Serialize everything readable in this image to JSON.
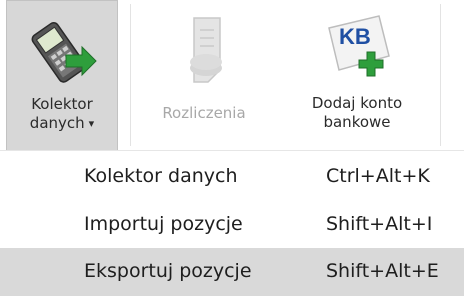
{
  "ribbon": {
    "kolektor": {
      "label_line1": "Kolektor",
      "label_line2": "danych",
      "caret": "▾",
      "icon": "data-collector-icon"
    },
    "rozliczenia": {
      "label": "Rozliczenia",
      "icon": "settlements-icon",
      "state": "disabled"
    },
    "dodaj": {
      "label_line1": "Dodaj konto",
      "label_line2": "bankowe",
      "icon_text": "KB",
      "icon": "add-bank-account-icon"
    }
  },
  "menu": {
    "items": [
      {
        "label": "Kolektor danych",
        "shortcut": "Ctrl+Alt+K"
      },
      {
        "label": "Importuj pozycje",
        "shortcut": "Shift+Alt+I"
      },
      {
        "label": "Eksportuj pozycje",
        "shortcut": "Shift+Alt+E",
        "highlighted": true
      }
    ]
  },
  "colors": {
    "pressed_bg": "#d7d7d7",
    "highlight_bg": "#d9d9d9",
    "kb_blue": "#1f4fa3",
    "plus_green": "#2e9e3c"
  }
}
